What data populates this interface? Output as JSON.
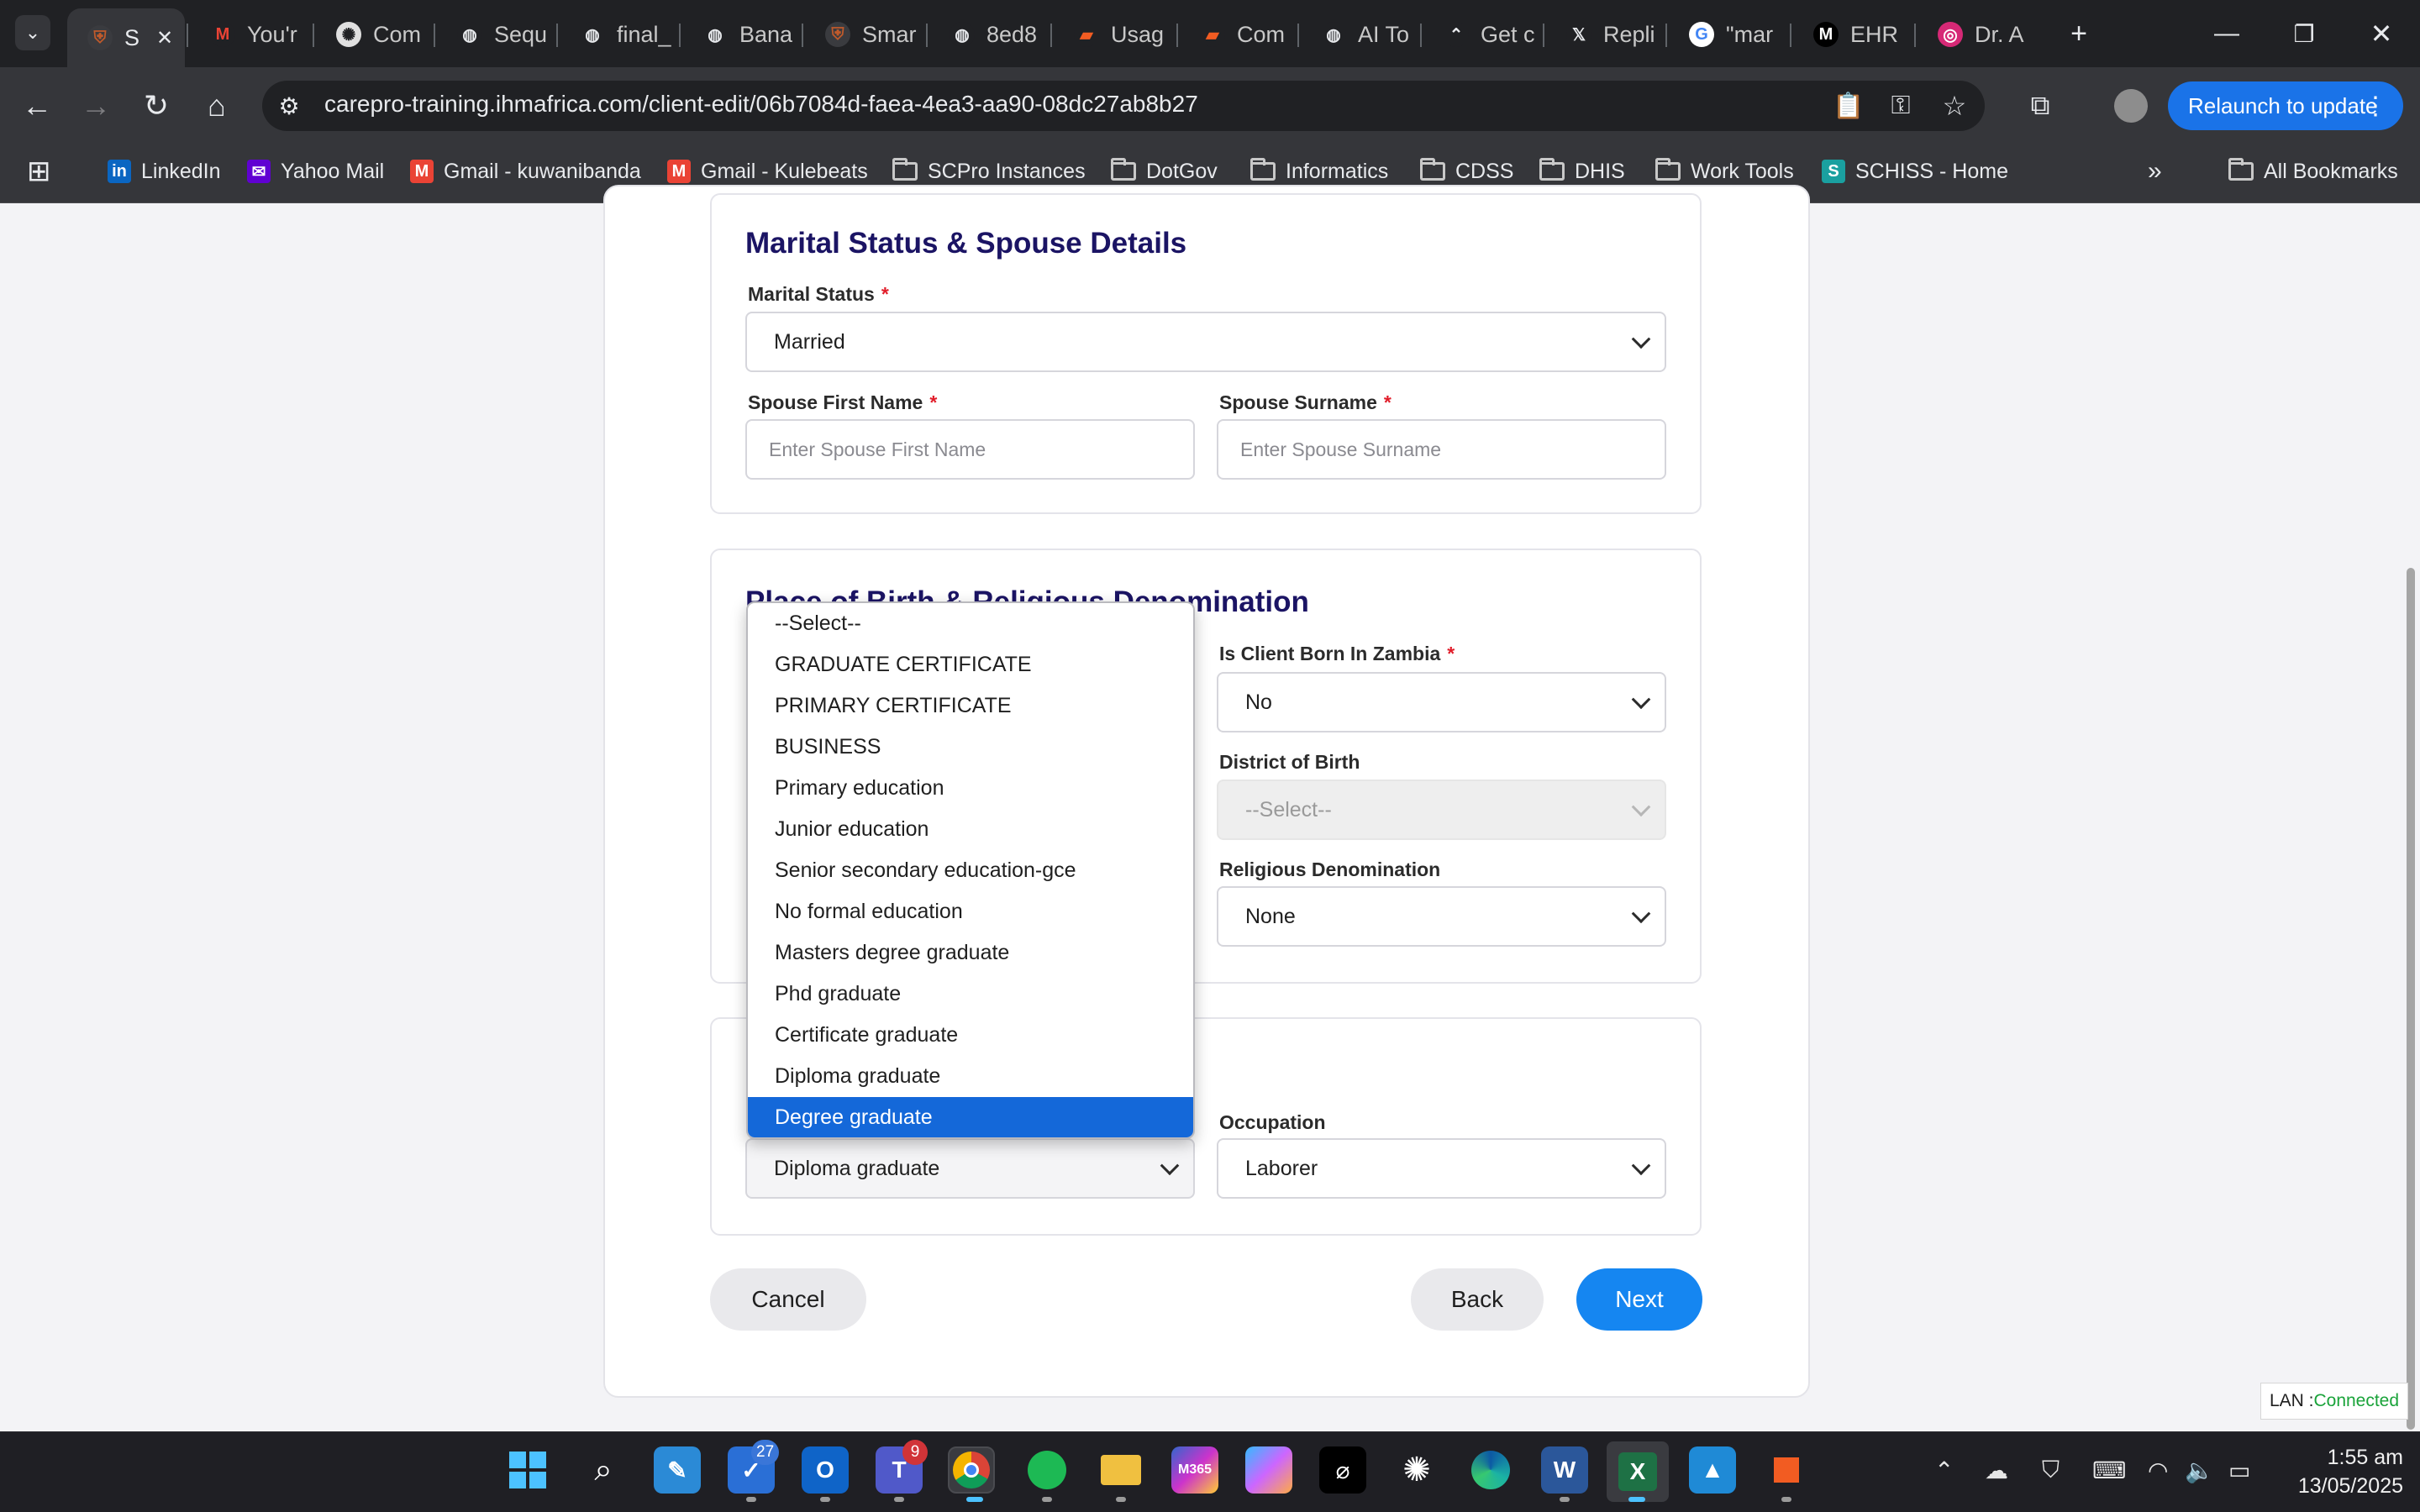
{
  "browser": {
    "tabs": [
      {
        "label": "S",
        "icon": "coat-of-arms-icon",
        "active": true
      },
      {
        "label": "You'r",
        "icon": "gmail-icon"
      },
      {
        "label": "Com",
        "icon": "chatgpt-icon"
      },
      {
        "label": "Sequ",
        "icon": "globe-icon"
      },
      {
        "label": "final_",
        "icon": "globe-icon"
      },
      {
        "label": "Bana",
        "icon": "globe-icon"
      },
      {
        "label": "Smar",
        "icon": "coat-of-arms-icon"
      },
      {
        "label": "8ed8",
        "icon": "globe-icon"
      },
      {
        "label": "Usag",
        "icon": "orange-logo-icon"
      },
      {
        "label": "Com",
        "icon": "orange-logo-icon"
      },
      {
        "label": "AI To",
        "icon": "globe-icon"
      },
      {
        "label": "Get c",
        "icon": "perplexity-icon"
      },
      {
        "label": "Repli",
        "icon": "x-icon"
      },
      {
        "label": "\"mar",
        "icon": "google-icon"
      },
      {
        "label": "EHR",
        "icon": "medium-icon"
      },
      {
        "label": "Dr. A",
        "icon": "instagram-icon"
      }
    ],
    "url": "carepro-training.ihmafrica.com/client-edit/06b7084d-faea-4ea3-aa90-08dc27ab8b27",
    "relaunch_label": "Relaunch to update",
    "bookmarks": [
      {
        "label": "LinkedIn",
        "icon": "linkedin-icon"
      },
      {
        "label": "Yahoo Mail",
        "icon": "yahoo-icon"
      },
      {
        "label": "Gmail - kuwanibanda",
        "icon": "gmail-icon"
      },
      {
        "label": "Gmail - Kulebeats",
        "icon": "gmail-icon"
      },
      {
        "label": "SCPro Instances",
        "icon": "folder-icon"
      },
      {
        "label": "DotGov",
        "icon": "folder-icon"
      },
      {
        "label": "Informatics",
        "icon": "folder-icon"
      },
      {
        "label": "CDSS",
        "icon": "folder-icon"
      },
      {
        "label": "DHIS",
        "icon": "folder-icon"
      },
      {
        "label": "Work Tools",
        "icon": "folder-icon"
      },
      {
        "label": "SCHISS - Home",
        "icon": "schiss-icon"
      }
    ],
    "all_bookmarks": "All Bookmarks"
  },
  "form": {
    "marital": {
      "title": "Marital Status & Spouse Details",
      "marital_status_label": "Marital Status",
      "marital_status_value": "Married",
      "spouse_first_label": "Spouse First Name",
      "spouse_first_placeholder": "Enter Spouse First Name",
      "spouse_surname_label": "Spouse Surname",
      "spouse_surname_placeholder": "Enter Spouse Surname"
    },
    "birth": {
      "title": "Place of Birth & Religious Denomination",
      "born_in_zambia_label": "Is Client Born In Zambia",
      "born_in_zambia_value": "No",
      "district_label": "District of Birth",
      "district_value": "--Select--",
      "religion_label": "Religious Denomination",
      "religion_value": "None"
    },
    "education": {
      "education_value": "Diploma graduate",
      "occupation_label": "Occupation",
      "occupation_value": "Laborer"
    },
    "required_mark": "*",
    "buttons": {
      "cancel": "Cancel",
      "back": "Back",
      "next": "Next"
    },
    "education_options": [
      "--Select--",
      "GRADUATE CERTIFICATE",
      "PRIMARY CERTIFICATE",
      "BUSINESS",
      "Primary education",
      "Junior education",
      "Senior secondary education-gce",
      "No formal education",
      "Masters degree graduate",
      "Phd graduate",
      "Certificate graduate",
      "Diploma graduate",
      "Degree graduate"
    ],
    "highlighted_option": "Degree graduate"
  },
  "status": {
    "lan_prefix": "LAN : ",
    "lan_state": "Connected"
  },
  "taskbar": {
    "teams_badge": "9",
    "todo_badge": "27",
    "time": "1:55 am",
    "date": "13/05/2025"
  },
  "colors": {
    "accent": "#1586f1",
    "title": "#1b1464",
    "required": "#e11d2a",
    "highlight": "#1468d9"
  }
}
